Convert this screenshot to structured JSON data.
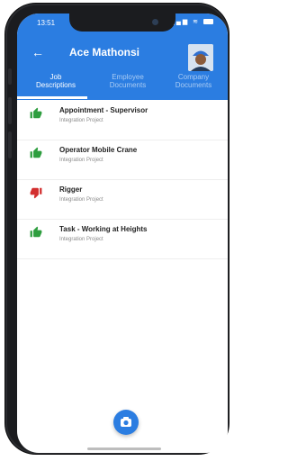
{
  "status_bar": {
    "time": "13:51",
    "signal": "signal-icon",
    "wifi": "wifi-icon",
    "battery": "battery-icon"
  },
  "header": {
    "title": "Ace Mathonsi",
    "back_icon": "back-arrow-icon"
  },
  "tabs": [
    {
      "label_line1": "Job",
      "label_line2": "Descriptions",
      "active": true
    },
    {
      "label_line1": "Employee",
      "label_line2": "Documents",
      "active": false
    },
    {
      "label_line1": "Company",
      "label_line2": "Documents",
      "active": false
    }
  ],
  "items": [
    {
      "title": "Appointment - Supervisor",
      "subtitle": "Integration Project",
      "status": "thumbs-up-icon"
    },
    {
      "title": "Operator Mobile Crane",
      "subtitle": "Integration Project",
      "status": "thumbs-up-icon"
    },
    {
      "title": "Rigger",
      "subtitle": "Integration Project",
      "status": "thumbs-down-icon"
    },
    {
      "title": "Task - Working at Heights",
      "subtitle": "Integration Project",
      "status": "thumbs-up-icon"
    }
  ],
  "fab": {
    "icon": "camera-icon"
  },
  "colors": {
    "primary": "#2b7de1",
    "approve": "#2e9e3f",
    "reject": "#d32f2f"
  }
}
